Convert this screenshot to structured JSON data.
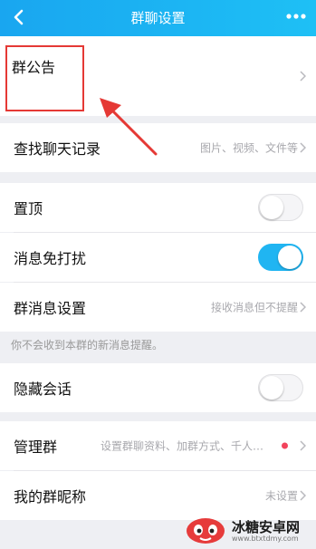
{
  "header": {
    "title": "群聊设置",
    "back_icon": "chevron-left-icon",
    "more_icon": "more-dots-icon"
  },
  "announcement": {
    "label": "群公告"
  },
  "search_history": {
    "label": "查找聊天记录",
    "value": "图片、视频、文件等"
  },
  "pin_top": {
    "label": "置顶",
    "on": false
  },
  "mute": {
    "label": "消息免打扰",
    "on": true
  },
  "msg_settings": {
    "label": "群消息设置",
    "value": "接收消息但不提醒"
  },
  "note": "你不会收到本群的新消息提醒。",
  "hide_chat": {
    "label": "隐藏会话",
    "on": false
  },
  "manage": {
    "label": "管理群",
    "value": "设置群聊资料、加群方式、千人…"
  },
  "nickname": {
    "label": "我的群昵称",
    "value": "未设置"
  },
  "watermark": {
    "name": "冰糖安卓网",
    "url": "www.btxtdmy.com"
  },
  "colors": {
    "accent": "#1ec0f5",
    "toggle_on": "#20b5f2",
    "highlight": "#e53935",
    "badge": "#f2435c"
  }
}
